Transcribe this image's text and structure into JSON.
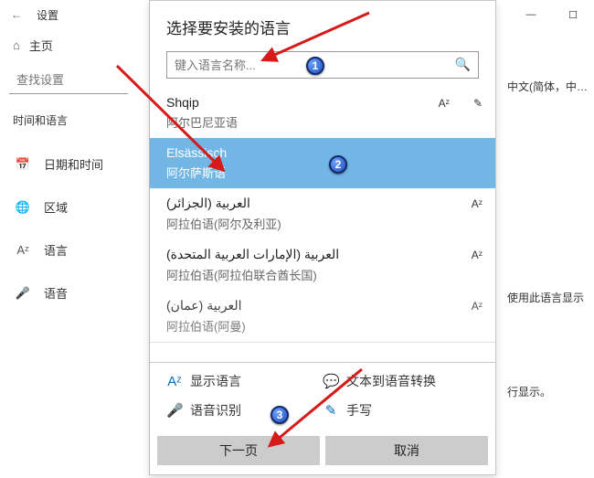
{
  "bg": {
    "title": "设置",
    "home": "主页",
    "search_placeholder": "查找设置",
    "category": "时间和语言",
    "nav": [
      {
        "icon": "📅",
        "label": "日期和时间"
      },
      {
        "icon": "🌐",
        "label": "区域"
      },
      {
        "icon": "Aᶻ",
        "label": "语言"
      },
      {
        "icon": "🎤",
        "label": "语音"
      }
    ],
    "right1": "中文(简体，中…",
    "right2": "使用此语言显示",
    "right3": "行显示。"
  },
  "dialog": {
    "title": "选择要安装的语言",
    "search_placeholder": "键入语言名称...",
    "languages": [
      {
        "name": "Shqip",
        "sub": "阿尔巴尼亚语",
        "feat": [
          "Aᶻ",
          "✎"
        ],
        "selected": false
      },
      {
        "name": "Elsässisch",
        "sub": "阿尔萨斯语",
        "feat": [],
        "selected": true
      },
      {
        "name": "العربية (الجزائر)",
        "sub": "阿拉伯语(阿尔及利亚)",
        "feat": [
          "Aᶻ"
        ],
        "selected": false
      },
      {
        "name": "العربية (الإمارات العربية المتحدة)",
        "sub": "阿拉伯语(阿拉伯联合酋长国)",
        "feat": [
          "Aᶻ"
        ],
        "selected": false
      },
      {
        "name": "العربية (عمان)",
        "sub": "阿拉伯语(阿曼)",
        "feat": [
          "Aᶻ"
        ],
        "selected": false
      }
    ],
    "legend": {
      "display": "显示语言",
      "tts": "文本到语音转换",
      "speech": "语音识别",
      "handwriting": "手写"
    },
    "btn_next": "下一页",
    "btn_cancel": "取消"
  },
  "anno": {
    "b1": "1",
    "b2": "2",
    "b3": "3"
  }
}
